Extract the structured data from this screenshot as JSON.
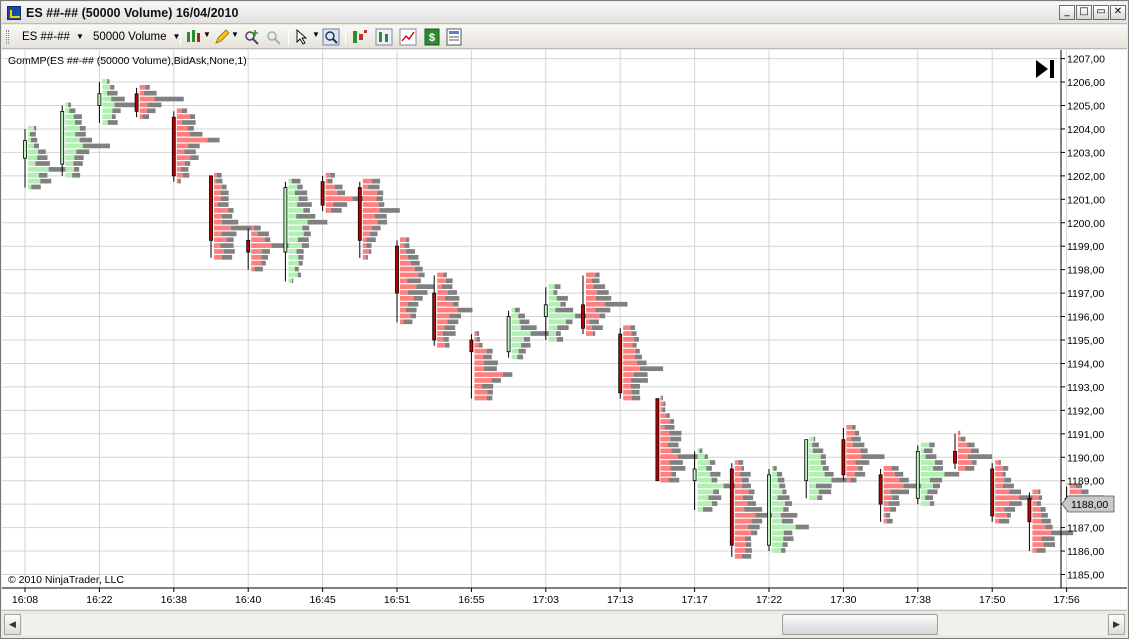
{
  "window": {
    "title": "ES ##-## (50000 Volume)  16/04/2010"
  },
  "toolbar": {
    "instrument": "ES ##-##",
    "period": "50000 Volume"
  },
  "chart": {
    "indicator_label": "GomMP(ES ##-## (50000 Volume),BidAsk,None,1)",
    "copyright": "© 2010 NinjaTrader, LLC",
    "current_price_label": "1188,00"
  },
  "chart_data": {
    "type": "candlestick",
    "ylim": [
      1184.5,
      1207.5
    ],
    "y_ticks": [
      "1185,00",
      "1186,00",
      "1187,00",
      "1188,00",
      "1189,00",
      "1190,00",
      "1191,00",
      "1192,00",
      "1193,00",
      "1194,00",
      "1195,00",
      "1196,00",
      "1197,00",
      "1198,00",
      "1199,00",
      "1200,00",
      "1201,00",
      "1202,00",
      "1203,00",
      "1204,00",
      "1205,00",
      "1206,00",
      "1207,00"
    ],
    "x_ticks": [
      "16:08",
      "16:22",
      "16:38",
      "16:40",
      "16:45",
      "16:51",
      "16:55",
      "17:03",
      "17:13",
      "17:17",
      "17:22",
      "17:30",
      "17:38",
      "17:50",
      "17:56"
    ],
    "colors": {
      "up_body": "#b5f5b5",
      "down_body": "#c00000",
      "ask_bar": "#808080",
      "bid_bar": "#ff7f7f",
      "up_bid_bar": "#b0f0b0",
      "grid": "#d4d4d4"
    },
    "bars": [
      {
        "open": 1202.75,
        "high": 1204.0,
        "low": 1201.5,
        "close": 1203.5
      },
      {
        "open": 1202.5,
        "high": 1205.0,
        "low": 1202.0,
        "close": 1204.75
      },
      {
        "open": 1205.0,
        "high": 1206.0,
        "low": 1204.25,
        "close": 1205.5
      },
      {
        "open": 1205.5,
        "high": 1205.75,
        "low": 1204.5,
        "close": 1204.75
      },
      {
        "open": 1204.5,
        "high": 1204.75,
        "low": 1201.75,
        "close": 1202.0
      },
      {
        "open": 1202.0,
        "high": 1202.0,
        "low": 1198.5,
        "close": 1199.25
      },
      {
        "open": 1199.25,
        "high": 1199.75,
        "low": 1198.0,
        "close": 1198.75
      },
      {
        "open": 1198.75,
        "high": 1201.75,
        "low": 1197.5,
        "close": 1201.5
      },
      {
        "open": 1201.75,
        "high": 1202.0,
        "low": 1200.5,
        "close": 1200.75
      },
      {
        "open": 1201.5,
        "high": 1201.75,
        "low": 1198.5,
        "close": 1199.25
      },
      {
        "open": 1199.0,
        "high": 1199.25,
        "low": 1195.75,
        "close": 1197.0
      },
      {
        "open": 1197.0,
        "high": 1197.75,
        "low": 1194.75,
        "close": 1195.0
      },
      {
        "open": 1195.0,
        "high": 1195.25,
        "low": 1192.5,
        "close": 1194.5
      },
      {
        "open": 1194.5,
        "high": 1196.25,
        "low": 1194.25,
        "close": 1196.0
      },
      {
        "open": 1196.0,
        "high": 1197.25,
        "low": 1195.0,
        "close": 1196.5
      },
      {
        "open": 1196.5,
        "high": 1197.75,
        "low": 1195.25,
        "close": 1195.5
      },
      {
        "open": 1195.25,
        "high": 1195.5,
        "low": 1192.5,
        "close": 1192.75
      },
      {
        "open": 1192.5,
        "high": 1192.5,
        "low": 1189.0,
        "close": 1189.0
      },
      {
        "open": 1189.0,
        "high": 1190.25,
        "low": 1187.75,
        "close": 1189.5
      },
      {
        "open": 1189.5,
        "high": 1189.75,
        "low": 1185.75,
        "close": 1186.25
      },
      {
        "open": 1186.25,
        "high": 1189.5,
        "low": 1186.0,
        "close": 1189.25
      },
      {
        "open": 1189.0,
        "high": 1190.75,
        "low": 1188.25,
        "close": 1190.75
      },
      {
        "open": 1190.75,
        "high": 1191.25,
        "low": 1189.0,
        "close": 1189.25
      },
      {
        "open": 1189.25,
        "high": 1189.5,
        "low": 1187.25,
        "close": 1188.0
      },
      {
        "open": 1188.25,
        "high": 1190.5,
        "low": 1188.0,
        "close": 1190.25
      },
      {
        "open": 1190.25,
        "high": 1191.0,
        "low": 1189.5,
        "close": 1189.75
      },
      {
        "open": 1189.5,
        "high": 1189.75,
        "low": 1187.25,
        "close": 1187.5
      },
      {
        "open": 1188.25,
        "high": 1188.5,
        "low": 1186.0,
        "close": 1187.25
      },
      {
        "open": 1188.25,
        "high": 1188.75,
        "low": 1187.75,
        "close": 1188.0
      }
    ]
  }
}
